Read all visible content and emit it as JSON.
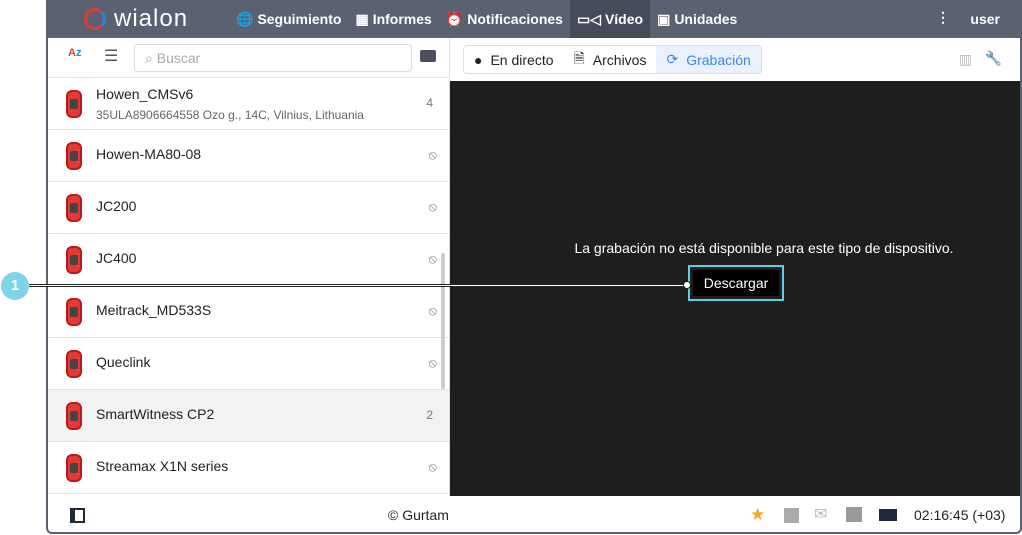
{
  "header": {
    "brand": "wialon",
    "nav": [
      {
        "label": "Seguimiento",
        "icon": "globe-icon"
      },
      {
        "label": "Informes",
        "icon": "report-icon"
      },
      {
        "label": "Notificaciones",
        "icon": "alarm-icon"
      },
      {
        "label": "Vídeo",
        "icon": "video-icon",
        "active": true
      },
      {
        "label": "Unidades",
        "icon": "bus-icon"
      }
    ],
    "user": "user"
  },
  "sidebar": {
    "search_placeholder": "Buscar",
    "units": [
      {
        "name": "Howen_CMSv6",
        "address": "35ULA8906664558 Ozo g., 14C, Vilnius, Lithuania",
        "count": "4"
      },
      {
        "name": "Howen-MA80-08"
      },
      {
        "name": "JC200"
      },
      {
        "name": "JC400"
      },
      {
        "name": "Meitrack_MD533S"
      },
      {
        "name": "Queclink"
      },
      {
        "name": "SmartWitness CP2",
        "count": "2",
        "selected": true
      },
      {
        "name": "Streamax X1N series"
      }
    ]
  },
  "main": {
    "tabs": [
      "En directo",
      "Archivos",
      "Grabación"
    ],
    "active_tab": "Grabación",
    "message": "La grabación no está disponible para este tipo de dispositivo.",
    "download_label": "Descargar"
  },
  "footer": {
    "copyright": "© Gurtam",
    "time": "02:16:45 (+03)"
  },
  "callout": {
    "number": "1"
  },
  "colors": {
    "header": "#5a6170",
    "accent": "#3b86e8",
    "callout": "#7dd3e8"
  }
}
